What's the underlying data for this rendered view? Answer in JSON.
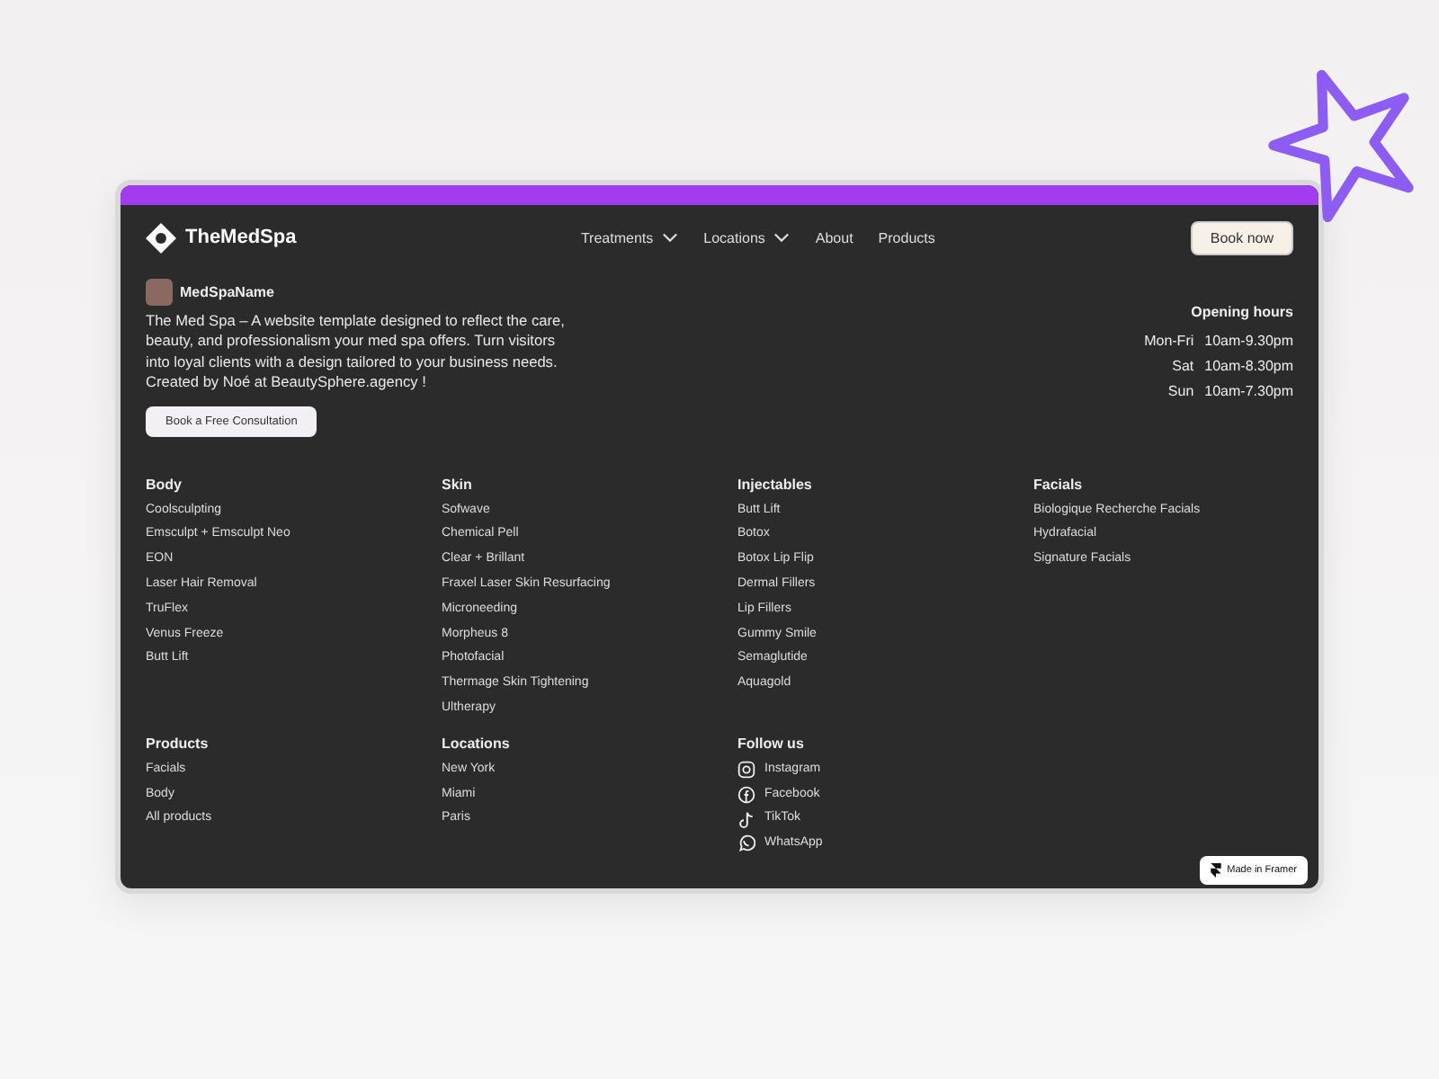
{
  "brand": "TheMedSpa",
  "nav": [
    {
      "label": "Treatments",
      "dropdown": true
    },
    {
      "label": "Locations",
      "dropdown": true
    },
    {
      "label": "About",
      "dropdown": false
    },
    {
      "label": "Products",
      "dropdown": false
    }
  ],
  "book_button": "Book now",
  "profile": {
    "name": "MedSpaName",
    "description": "The Med Spa – A website template designed to reflect the care, beauty, and professionalism your med spa offers. Turn visitors into loyal clients with a design tailored to your business needs. Created by Noé at BeautySphere.agency !",
    "button": "Book a Free Consultation"
  },
  "opening_hours": {
    "title": "Opening hours",
    "rows": [
      {
        "days": "Mon-Fri",
        "hours": "10am-9.30pm"
      },
      {
        "days": "Sat",
        "hours": "10am-8.30pm"
      },
      {
        "days": "Sun",
        "hours": "10am-7.30pm"
      }
    ]
  },
  "treatment_columns": [
    {
      "title": "Body",
      "items": [
        "Coolsculpting",
        "Emsculpt + Emsculpt Neo",
        "EON",
        "Laser Hair Removal",
        "TruFlex",
        "Venus Freeze",
        "Butt Lift"
      ]
    },
    {
      "title": "Skin",
      "items": [
        "Sofwave",
        "Chemical Pell",
        "Clear + Brillant",
        "Fraxel Laser Skin Resurfacing",
        "Microneeding",
        "Morpheus 8",
        "Photofacial",
        "Thermage Skin Tightening",
        "Ultherapy"
      ]
    },
    {
      "title": "Injectables",
      "items": [
        "Butt Lift",
        "Botox",
        "Botox Lip Flip",
        "Dermal Fillers",
        "Lip Fillers",
        "Gummy Smile",
        "Semaglutide",
        "Aquagold"
      ]
    },
    {
      "title": "Facials",
      "items": [
        "Biologique Recherche Facials",
        "Hydrafacial",
        "Signature Facials"
      ]
    }
  ],
  "bottom_columns": [
    {
      "title": "Products",
      "items": [
        "Facials",
        "Body",
        "All products"
      ]
    },
    {
      "title": "Locations",
      "items": [
        "New York",
        "Miami",
        "Paris"
      ]
    }
  ],
  "follow_us": {
    "title": "Follow us",
    "links": [
      {
        "kind": "instagram",
        "label": "Instagram"
      },
      {
        "kind": "facebook",
        "label": "Facebook"
      },
      {
        "kind": "tiktok",
        "label": "TikTok"
      },
      {
        "kind": "whatsapp",
        "label": "WhatsApp"
      }
    ]
  },
  "framer_badge": "Made in Framer"
}
